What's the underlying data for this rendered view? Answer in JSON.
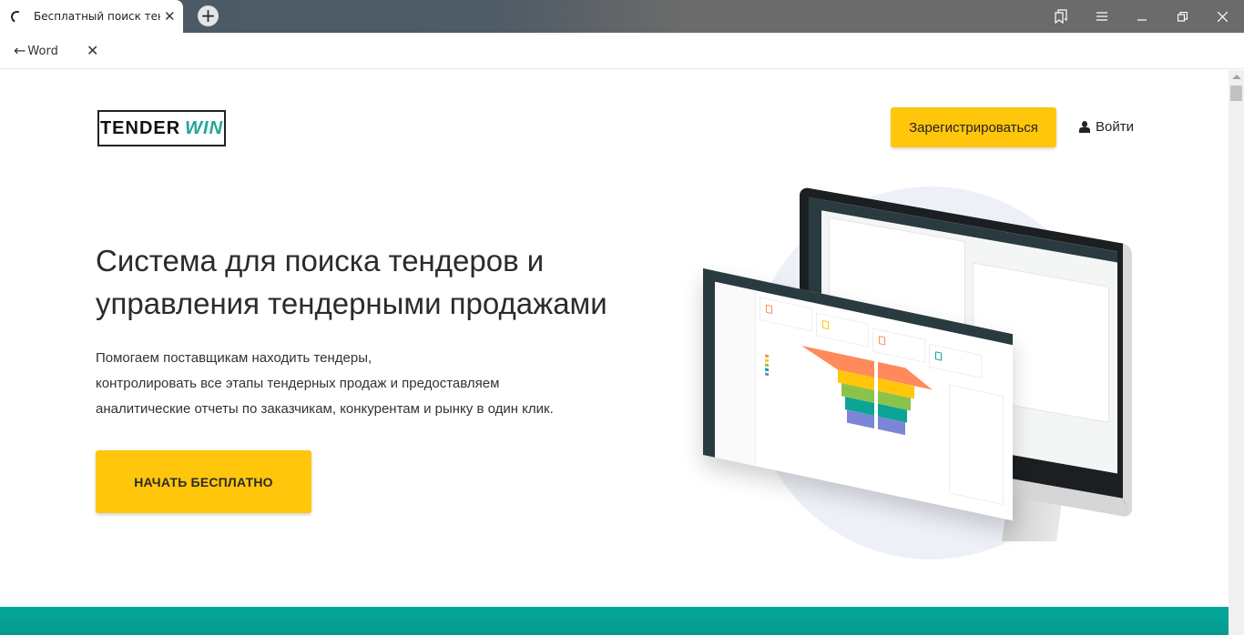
{
  "browser": {
    "tab": {
      "title": "Бесплатный поиск тендеров",
      "close_icon": "close-icon",
      "loading_icon": "loading-spinner-icon"
    },
    "new_tab_symbol": "+",
    "window_controls": [
      "bookmarks-icon",
      "menu-icon",
      "minimize-icon",
      "restore-icon",
      "close-icon"
    ],
    "back_arrow": "←",
    "back_label": "Word",
    "close_symbol": "✕"
  },
  "header": {
    "logo": {
      "part1": "TENDER",
      "part2": "WIN"
    },
    "register_label": "Зарегистрироваться",
    "login_label": "Войти"
  },
  "hero": {
    "headline_line1": "Система для поиска тендеров и",
    "headline_line2": "управления тендерными продажами",
    "subtext": [
      "Помогаем поставщикам находить тендеры,",
      "контролировать все этапы тендерных продаж и предоставляем",
      "аналитические отчеты по заказчикам, конкурентам и рынку в один клик."
    ],
    "cta_label": "НАЧАТЬ БЕСПЛАТНО",
    "illustration": "product-dashboard-screenshots"
  },
  "colors": {
    "accent_yellow": "#ffc60b",
    "brand_teal": "#21a697",
    "band_teal": "#03a89b",
    "funnel": [
      "#ff8a5c",
      "#ffc60b",
      "#8bc34a",
      "#0aa596",
      "#7c86d6"
    ]
  }
}
